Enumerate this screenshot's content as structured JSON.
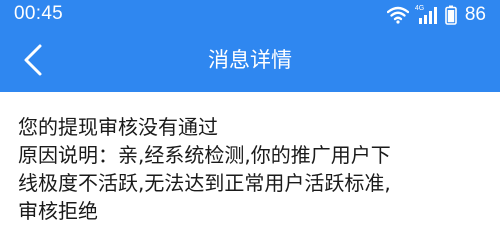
{
  "status_bar": {
    "time": "00:45",
    "network_label": "4G",
    "battery_percent": "86",
    "icons": [
      "wifi-icon",
      "signal-icon",
      "battery-icon"
    ]
  },
  "nav": {
    "title": "消息详情",
    "back_icon": "chevron-left-icon"
  },
  "message": {
    "heading": "您的提现审核没有通过",
    "body_lines": [
      "原因说明：亲,经系统检测,你的推广用户下",
      "线极度不活跃,无法达到正常用户活跃标准,",
      "审核拒绝"
    ]
  },
  "colors": {
    "header_bg": "#2f87f0",
    "text": "#1a1a1a",
    "page_bg": "#ffffff"
  }
}
